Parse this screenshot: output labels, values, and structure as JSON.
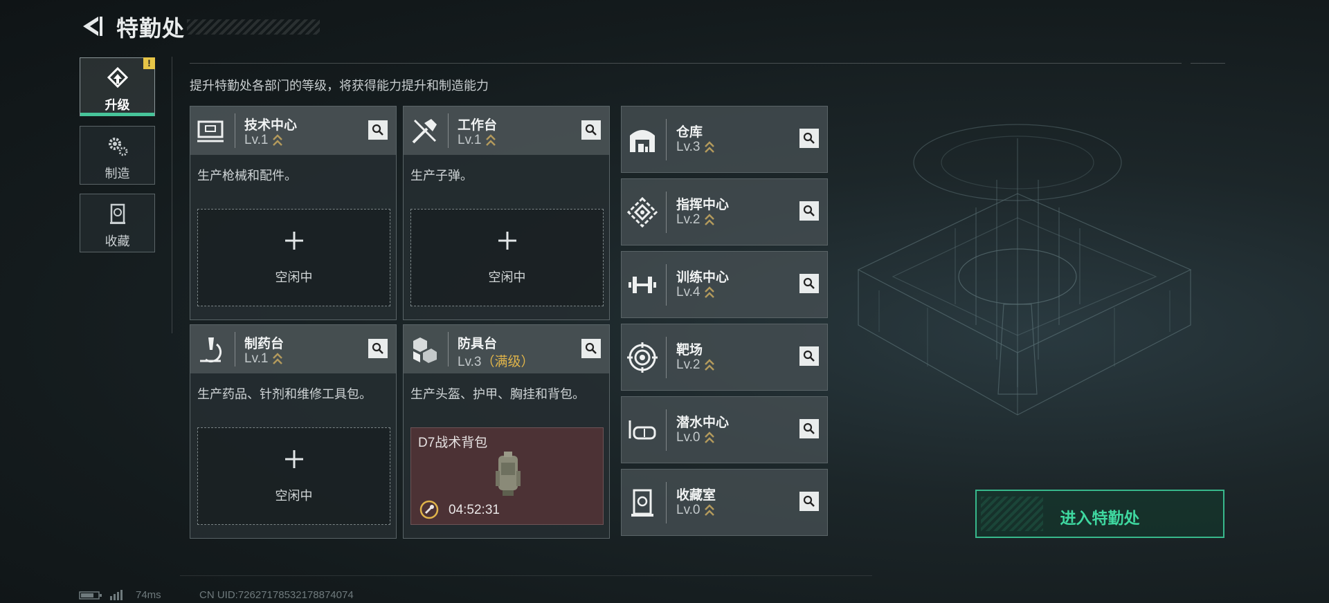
{
  "header": {
    "title": "特勤处"
  },
  "sidebar": {
    "alert_badge": "!",
    "tabs": [
      {
        "label": "升级",
        "icon": "upgrade-icon",
        "active": true
      },
      {
        "label": "制造",
        "icon": "gear-icon",
        "active": false
      },
      {
        "label": "收藏",
        "icon": "collection-icon",
        "active": false
      }
    ]
  },
  "subtitle": "提升特勤处各部门的等级，将获得能力提升和制造能力",
  "production_cards": [
    {
      "name": "技术中心",
      "level": "Lv.1",
      "max_tag": "",
      "icon": "monitor-icon",
      "desc": "生产枪械和配件。",
      "slot": {
        "plus": "+",
        "label": "空闲中"
      }
    },
    {
      "name": "工作台",
      "level": "Lv.1",
      "max_tag": "",
      "icon": "tools-icon",
      "desc": "生产子弹。",
      "slot": {
        "plus": "+",
        "label": "空闲中"
      }
    },
    {
      "name": "制药台",
      "level": "Lv.1",
      "max_tag": "",
      "icon": "microscope-icon",
      "desc": "生产药品、针剂和维修工具包。",
      "slot": {
        "plus": "+",
        "label": "空闲中"
      }
    },
    {
      "name": "防具台",
      "level": "Lv.3",
      "max_tag": "（满级）",
      "icon": "armor-boxes-icon",
      "desc": "生产头盔、护甲、胸挂和背包。",
      "crafting": {
        "item_name": "D7战术背包",
        "timer": "04:52:31",
        "item_icon": "backpack-icon",
        "timer_icon": "wrench-clock-icon"
      }
    }
  ],
  "facilities": [
    {
      "name": "仓库",
      "level": "Lv.3",
      "icon": "warehouse-icon"
    },
    {
      "name": "指挥中心",
      "level": "Lv.2",
      "icon": "command-icon"
    },
    {
      "name": "训练中心",
      "level": "Lv.4",
      "icon": "dumbbell-icon"
    },
    {
      "name": "靶场",
      "level": "Lv.2",
      "icon": "target-icon"
    },
    {
      "name": "潜水中心",
      "level": "Lv.0",
      "icon": "diving-mask-icon"
    },
    {
      "name": "收藏室",
      "level": "Lv.0",
      "icon": "collection-room-icon"
    }
  ],
  "enter_button": {
    "label": "进入特勤处"
  },
  "status_bar": {
    "ping": "74ms",
    "uid": "CN UID:72627178532178874074"
  },
  "colors": {
    "accent_green": "#3fd8a0",
    "max_gold": "#e0b44a",
    "level_chevron": "#b39a5c",
    "alert": "#e7c547",
    "crafting_bg": "#4c3235"
  }
}
